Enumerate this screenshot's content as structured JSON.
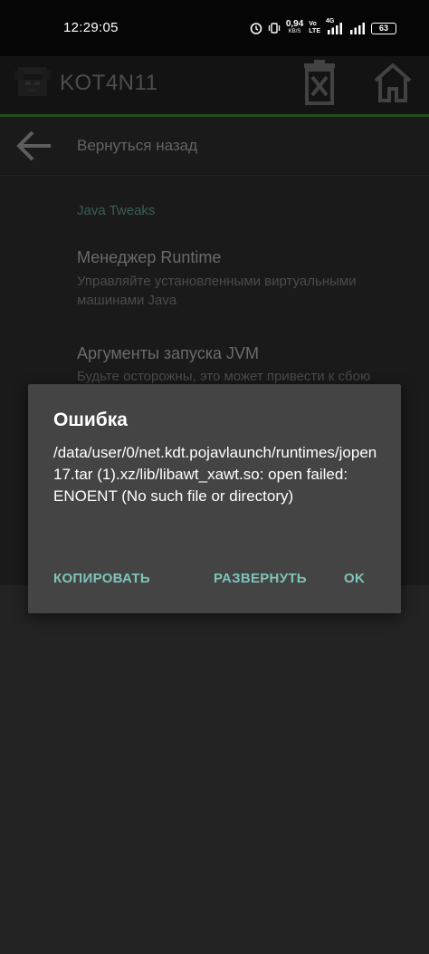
{
  "status_bar": {
    "time": "12:29:05",
    "speed_value": "0,94",
    "speed_unit": "KB/S",
    "network_vo": "Vo",
    "network_lte": "LTE",
    "network_type": "4G",
    "battery": "63"
  },
  "launcher": {
    "app_name": "KOT4N11"
  },
  "settings": {
    "back_label": "Вернуться назад",
    "category": "Java Tweaks",
    "items": [
      {
        "title": "Менеджер Runtime",
        "summary": "Управляйте установленными виртуальными машинами Java"
      },
      {
        "title": "Аргументы запуска JVM",
        "summary": "Будьте осторожны, это может привести к сбою"
      }
    ]
  },
  "dialog": {
    "title": "Ошибка",
    "message": "/data/user/0/net.kdt.pojavlaunch/runtimes/jopen17.tar (1).xz/lib/libawt_xawt.so: open failed: ENOENT (No such file or directory)",
    "buttons": {
      "copy": "КОПИРОВАТЬ",
      "expand": "РАЗВЕРНУТЬ",
      "ok": "OK"
    }
  },
  "colors": {
    "accent_text": "#7fc3bb",
    "dialog_bg": "#444444",
    "accent_line": "#1f4f1a"
  }
}
